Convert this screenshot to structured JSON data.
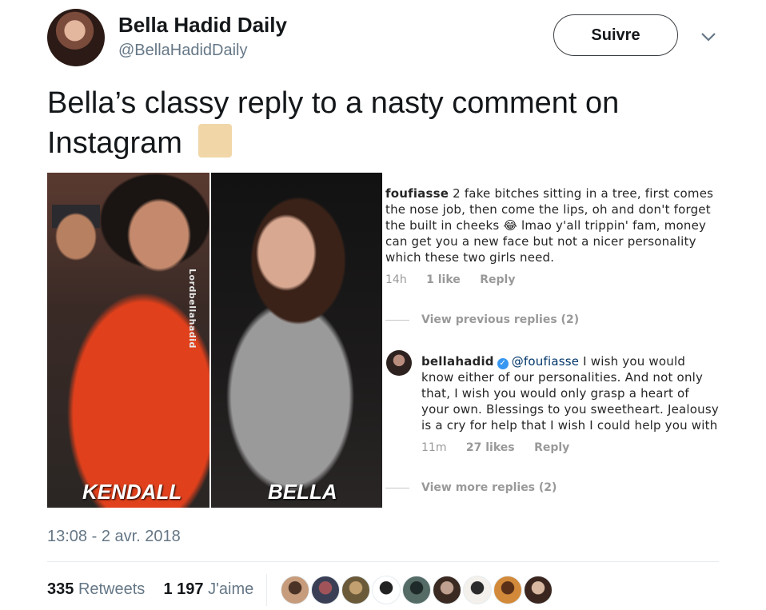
{
  "header": {
    "display_name": "Bella Hadid Daily",
    "handle": "@BellaHadidDaily",
    "follow_label": "Suivre"
  },
  "tweet": {
    "text": "Bella’s classy reply to a nasty comment on Instagram",
    "emoji_name": "raised-hands-emoji"
  },
  "media": {
    "watermark": "Lordbellahadid",
    "left_label": "KENDALL",
    "right_label": "BELLA",
    "instagram": {
      "comment1": {
        "user": "foufiasse",
        "text_a": "2 fake bitches sitting in a tree, first comes the nose job, then come the lips, oh and don't forget the built in cheeks",
        "emoji": "😂",
        "text_b": "lmao y'all trippin' fam, money can get you a new face but not a nicer personality which these two girls need.",
        "time": "14h",
        "likes": "1 like",
        "reply": "Reply"
      },
      "view_previous": "View previous replies (2)",
      "comment2": {
        "user": "bellahadid",
        "mention": "@foufiasse",
        "text": "I wish you would know either of our personalities. And not only that, I wish you would only grasp a heart of your own. Blessings to you sweetheart. Jealousy is a cry for help that I wish I could help you with",
        "time": "11m",
        "likes": "27 likes",
        "reply": "Reply"
      },
      "view_more": "View more replies (2)"
    }
  },
  "footer": {
    "timestamp": "13:08 - 2 avr. 2018",
    "retweets_count": "335",
    "retweets_label": "Retweets",
    "likes_count": "1 197",
    "likes_label": "J'aime"
  },
  "colors": {
    "muted": "#657786",
    "text": "#14171a",
    "divider": "#e6ecf0"
  },
  "likers": [
    {
      "name": "liker-avatar-1",
      "colors": [
        "#c69c7c",
        "#4a3226"
      ]
    },
    {
      "name": "liker-avatar-2",
      "colors": [
        "#3a3f55",
        "#a0545a"
      ]
    },
    {
      "name": "liker-avatar-3",
      "colors": [
        "#6b5a3a",
        "#c3a070"
      ]
    },
    {
      "name": "liker-avatar-4",
      "colors": [
        "#ffffff",
        "#222222"
      ]
    },
    {
      "name": "liker-avatar-5",
      "colors": [
        "#556b66",
        "#1f2b2a"
      ]
    },
    {
      "name": "liker-avatar-6",
      "colors": [
        "#3a2a22",
        "#c0a090"
      ]
    },
    {
      "name": "liker-avatar-7",
      "colors": [
        "#f4f1ec",
        "#2b2b2b"
      ]
    },
    {
      "name": "liker-avatar-8",
      "colors": [
        "#d28a3a",
        "#5a3018"
      ]
    },
    {
      "name": "liker-avatar-9",
      "colors": [
        "#3a261e",
        "#d8b8a0"
      ]
    }
  ]
}
